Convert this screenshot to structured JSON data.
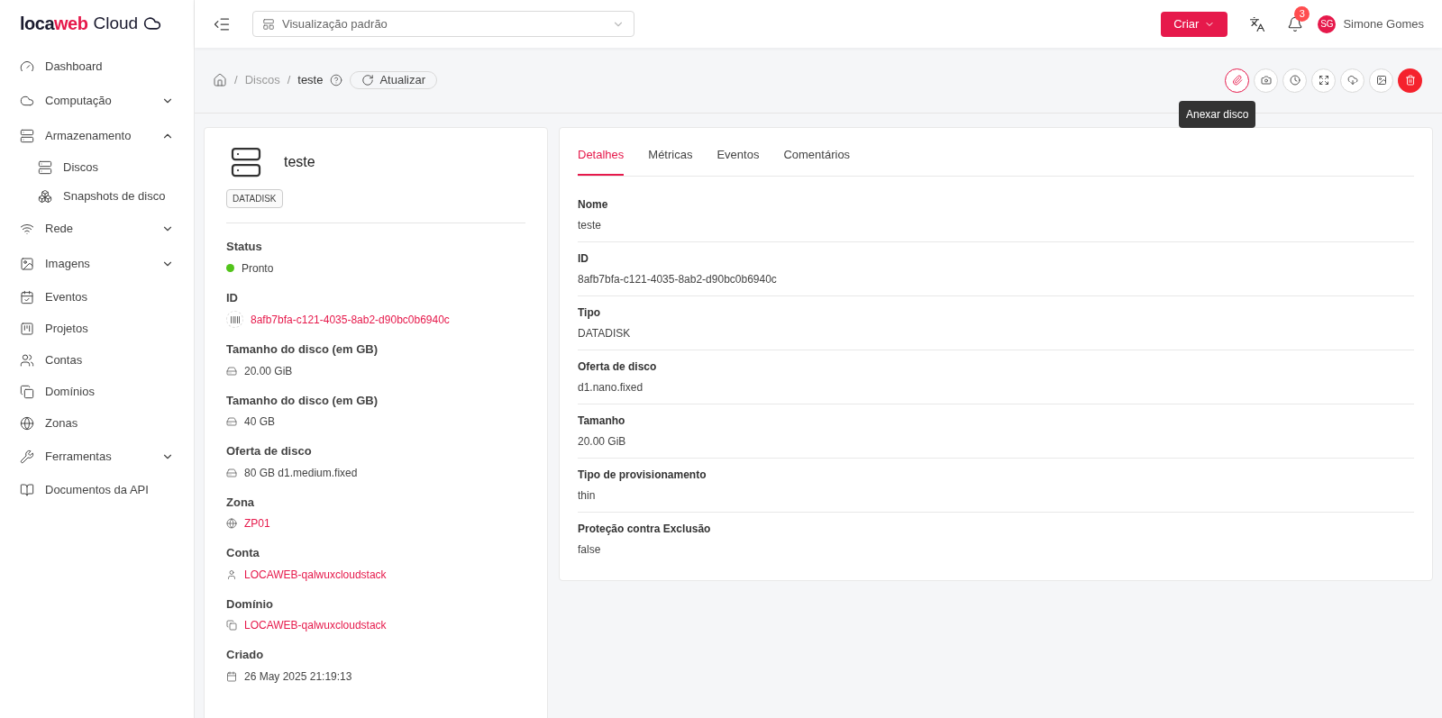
{
  "logo": {
    "brand": "locaweb",
    "product": "Cloud"
  },
  "sidebar": {
    "items": [
      {
        "kind": "item",
        "label": "Dashboard"
      },
      {
        "kind": "group",
        "label": "Computação",
        "expanded": false
      },
      {
        "kind": "group",
        "label": "Armazenamento",
        "expanded": true,
        "children": [
          {
            "label": "Discos"
          },
          {
            "label": "Snapshots de disco"
          }
        ]
      },
      {
        "kind": "group",
        "label": "Rede",
        "expanded": false
      },
      {
        "kind": "group",
        "label": "Imagens",
        "expanded": false
      },
      {
        "kind": "item",
        "label": "Eventos"
      },
      {
        "kind": "item",
        "label": "Projetos"
      },
      {
        "kind": "item",
        "label": "Contas"
      },
      {
        "kind": "item",
        "label": "Domínios"
      },
      {
        "kind": "item",
        "label": "Zonas"
      },
      {
        "kind": "group",
        "label": "Ferramentas",
        "expanded": false
      },
      {
        "kind": "item",
        "label": "Documentos da API"
      }
    ]
  },
  "header": {
    "view_select": {
      "value": "Visualização padrão"
    },
    "create_button": "Criar",
    "notifications": {
      "count": "3"
    },
    "user": {
      "initials": "SG",
      "name": "Simone Gomes"
    }
  },
  "breadcrumb": {
    "separators": [
      "/",
      "/"
    ],
    "items": [
      "Discos",
      "teste"
    ],
    "refresh_button": "Atualizar"
  },
  "actions": [
    {
      "kind": "attach",
      "highlighted": true,
      "tooltip": "Anexar disco"
    },
    {
      "kind": "camera",
      "highlighted": false
    },
    {
      "kind": "clock",
      "highlighted": false
    },
    {
      "kind": "resize",
      "highlighted": false
    },
    {
      "kind": "upload",
      "highlighted": false
    },
    {
      "kind": "image",
      "highlighted": false
    },
    {
      "kind": "delete"
    }
  ],
  "summary": {
    "name": "teste",
    "tag": "DATADISK",
    "fields": [
      {
        "label": "Status",
        "kind": "status",
        "value": "Pronto",
        "color": "#52c41a"
      },
      {
        "label": "ID",
        "kind": "id",
        "value": "8afb7bfa-c121-4035-8ab2-d90bc0b6940c",
        "link": true
      },
      {
        "label": "Tamanho do disco (em GB)",
        "kind": "disk",
        "value": "20.00 GiB",
        "link": false
      },
      {
        "label": "Tamanho do disco (em GB)",
        "kind": "disk",
        "value": "40 GB",
        "link": false
      },
      {
        "label": "Oferta de disco",
        "kind": "disk",
        "value": "80 GB d1.medium.fixed",
        "link": false
      },
      {
        "label": "Zona",
        "kind": "globe",
        "value": "ZP01",
        "link": true
      },
      {
        "label": "Conta",
        "kind": "user",
        "value": "LOCAWEB-qalwuxcloudstack",
        "link": true
      },
      {
        "label": "Domínio",
        "kind": "copy",
        "value": "LOCAWEB-qalwuxcloudstack",
        "link": true
      },
      {
        "label": "Criado",
        "kind": "calendar",
        "value": "26 May 2025 21:19:13",
        "link": false
      }
    ]
  },
  "tabs": [
    {
      "label": "Detalhes",
      "selected": true
    },
    {
      "label": "Métricas",
      "selected": false
    },
    {
      "label": "Eventos",
      "selected": false
    },
    {
      "label": "Comentários",
      "selected": false
    }
  ],
  "details": [
    {
      "label": "Nome",
      "value": "teste"
    },
    {
      "label": "ID",
      "value": "8afb7bfa-c121-4035-8ab2-d90bc0b6940c"
    },
    {
      "label": "Tipo",
      "value": "DATADISK"
    },
    {
      "label": "Oferta de disco",
      "value": "d1.nano.fixed"
    },
    {
      "label": "Tamanho",
      "value": "20.00 GiB"
    },
    {
      "label": "Tipo de provisionamento",
      "value": "thin"
    },
    {
      "label": "Proteção contra Exclusão",
      "value": "false"
    }
  ]
}
